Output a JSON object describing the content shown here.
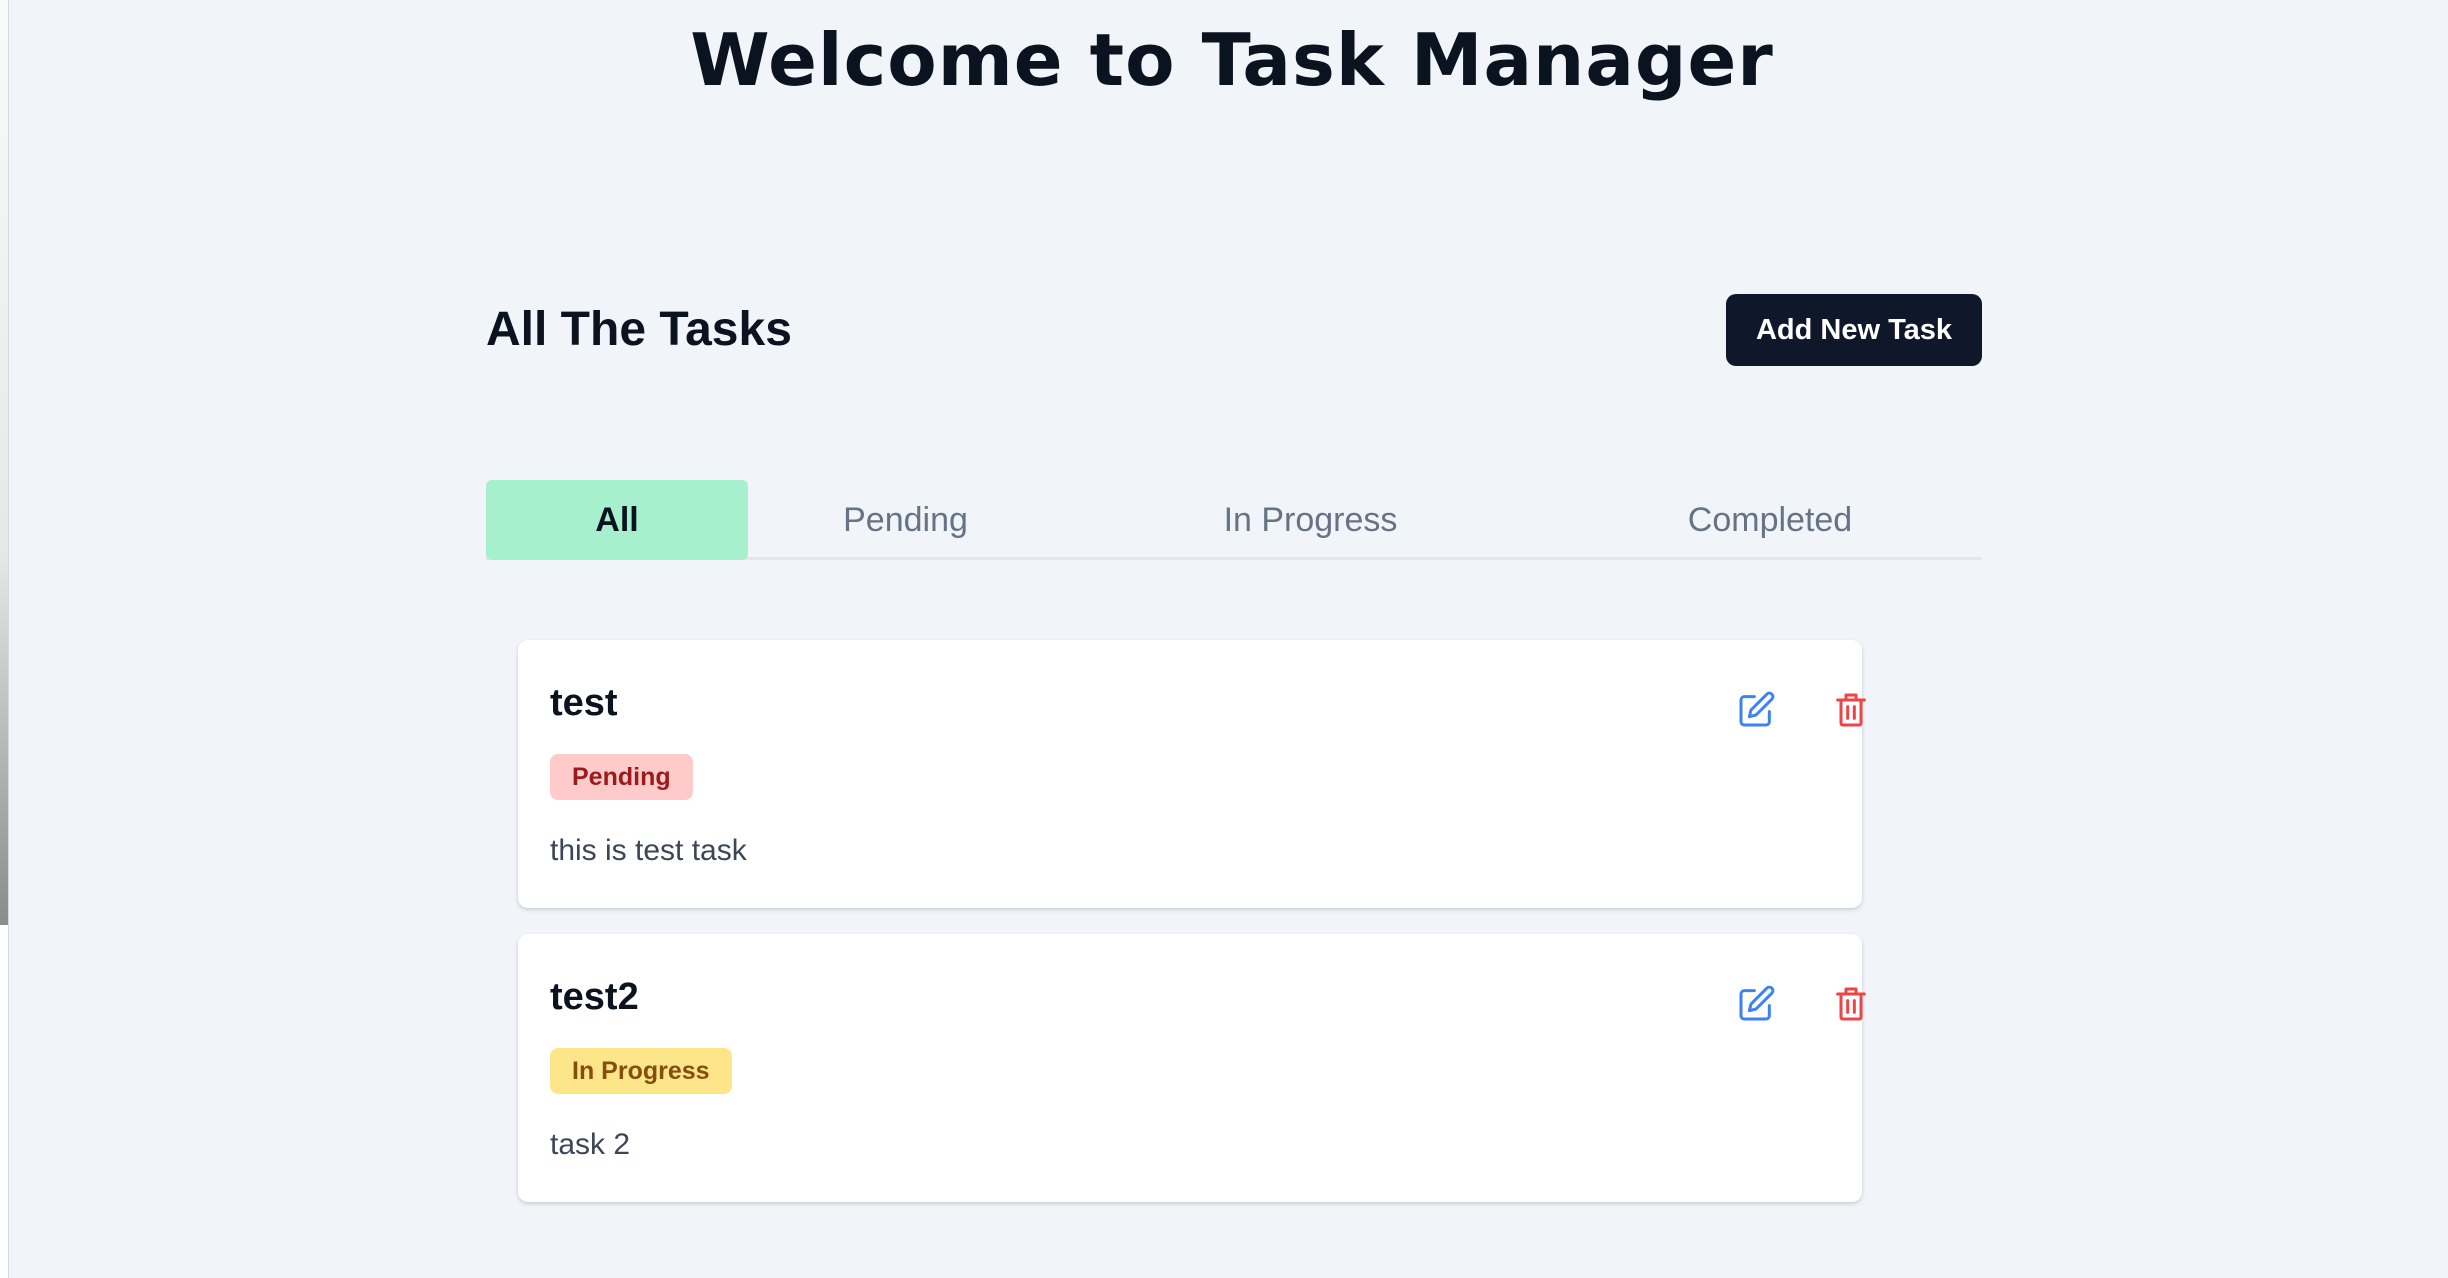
{
  "header": {
    "title": "Welcome to Task Manager"
  },
  "section": {
    "title": "All The Tasks",
    "add_button_label": "Add New Task"
  },
  "tabs": [
    {
      "label": "All",
      "active": true
    },
    {
      "label": "Pending",
      "active": false
    },
    {
      "label": "In Progress",
      "active": false
    },
    {
      "label": "Completed",
      "active": false
    }
  ],
  "tasks": [
    {
      "title": "test",
      "status": "Pending",
      "description": "this is test task",
      "edit_icon": "edit-icon",
      "delete_icon": "trash-icon"
    },
    {
      "title": "test2",
      "status": "In Progress",
      "description": "task 2",
      "edit_icon": "edit-icon",
      "delete_icon": "trash-icon"
    }
  ],
  "colors": {
    "active_tab_bg": "#a7f0cd",
    "add_button_bg": "#0f172a",
    "pending_badge_bg": "#fecaca",
    "pending_badge_text": "#991b1b",
    "progress_badge_bg": "#fde68a",
    "progress_badge_text": "#854d0e",
    "edit_icon": "#3b82f6",
    "delete_icon": "#ef4444"
  }
}
